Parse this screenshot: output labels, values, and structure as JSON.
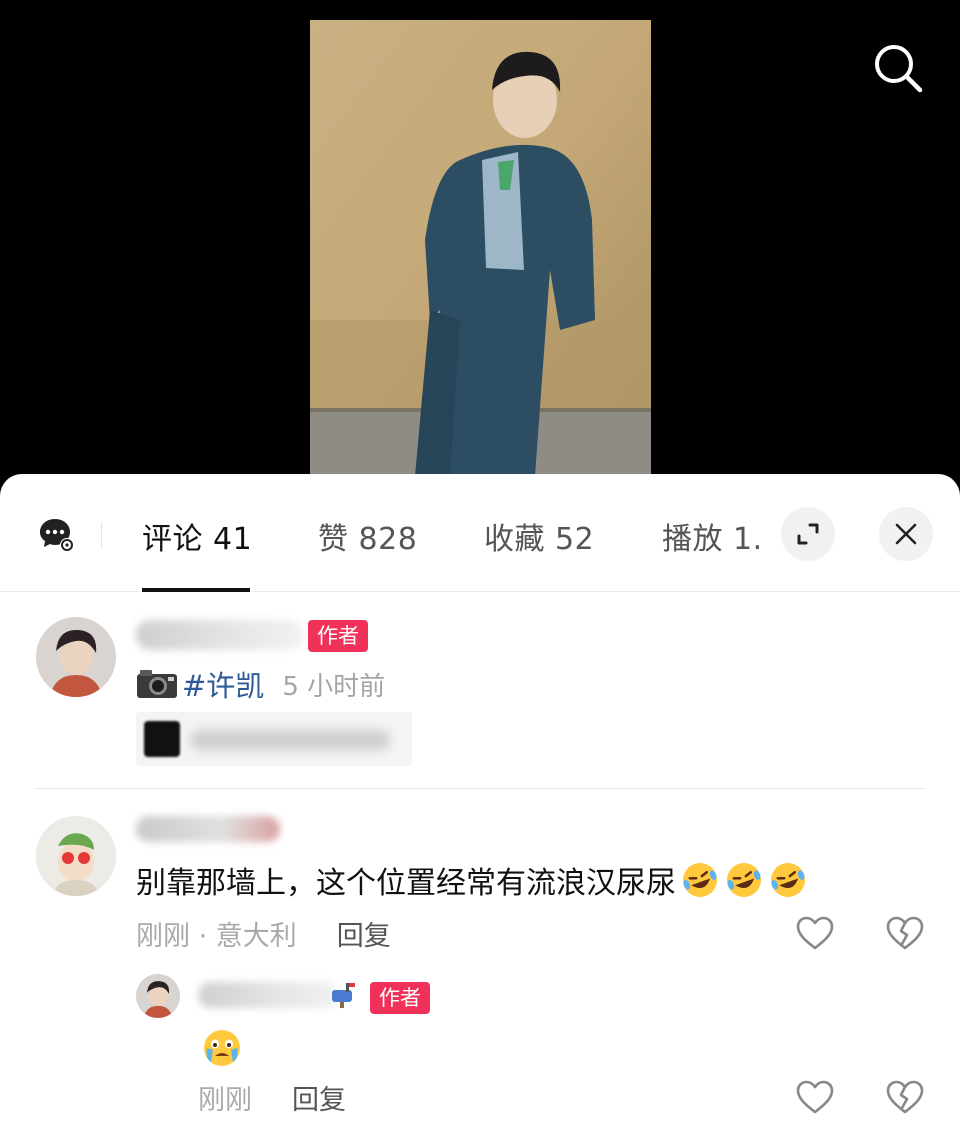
{
  "tabs": {
    "comments": "评论 41",
    "likes": "赞 828",
    "favorites": "收藏 52",
    "plays": "播放 1."
  },
  "icons": {
    "search": "search-icon",
    "comments_bubble": "chat-bubble-icon",
    "expand": "expand-icon",
    "close": "close-icon",
    "heart": "heart-icon",
    "dislike": "broken-heart-icon"
  },
  "author_post": {
    "tag": "作者",
    "hashtag": "#许凯",
    "time": "5 小时前"
  },
  "comment": {
    "text": "别靠那墙上，这个位置经常有流浪汉尿尿",
    "meta": "刚刚 · 意大利",
    "reply": "回复"
  },
  "reply": {
    "tag": "作者",
    "meta": "刚刚",
    "reply": "回复"
  },
  "colors": {
    "author_tag": "#f0315a",
    "hashtag": "#2e5a9a"
  }
}
